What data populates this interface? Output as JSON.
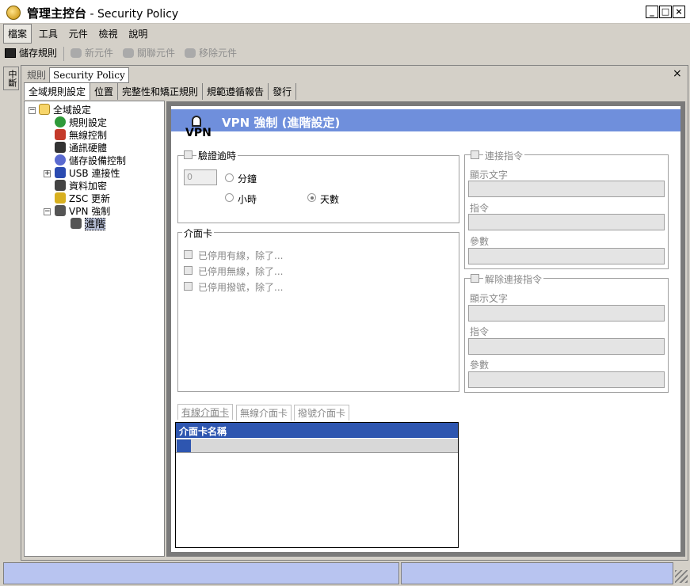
{
  "window": {
    "title_cn": "管理主控台",
    "title_sep": " - ",
    "title_en": "Security Policy",
    "min": "_",
    "max": "□",
    "close": "×"
  },
  "menu": [
    "檔案",
    "工具",
    "元件",
    "檢視",
    "說明"
  ],
  "toolbar": {
    "save": "儲存規則",
    "new": "新元件",
    "associate": "關聯元件",
    "remove": "移除元件"
  },
  "left_strip": "中斷",
  "doc_tabs": [
    "規則",
    "Security Policy"
  ],
  "doc_close": "×",
  "main_tabs": [
    "全域規則設定",
    "位置",
    "完整性和矯正規則",
    "規範遵循報告",
    "發行"
  ],
  "tree": {
    "root": "全域設定",
    "items": [
      "規則設定",
      "無線控制",
      "通訊硬體",
      "儲存設備控制",
      "USB 連接性",
      "資料加密",
      "ZSC 更新",
      "VPN 強制"
    ],
    "child": "進階",
    "expanders": [
      "−",
      "+",
      "−"
    ]
  },
  "header": {
    "title": "VPN 強制 (進階設定)",
    "logo_text": "VPN"
  },
  "timeout": {
    "label": "驗證逾時",
    "spin_value": "0",
    "minutes": "分鐘",
    "hours": "小時",
    "days": "天數"
  },
  "adapters": {
    "label": "介面卡",
    "wired": "已停用有線，除了...",
    "wireless": "已停用無線，除了...",
    "dialup": "已停用撥號，除了..."
  },
  "connect": {
    "label": "連接指令",
    "display_text": "顯示文字",
    "command": "指令",
    "params": "參數"
  },
  "disconnect": {
    "label": "解除連接指令",
    "display_text": "顯示文字",
    "command": "指令",
    "params": "參數"
  },
  "nic_tabs": [
    "有線介面卡",
    "無線介面卡",
    "撥號介面卡"
  ],
  "nic_table": {
    "header": "介面卡名稱"
  }
}
